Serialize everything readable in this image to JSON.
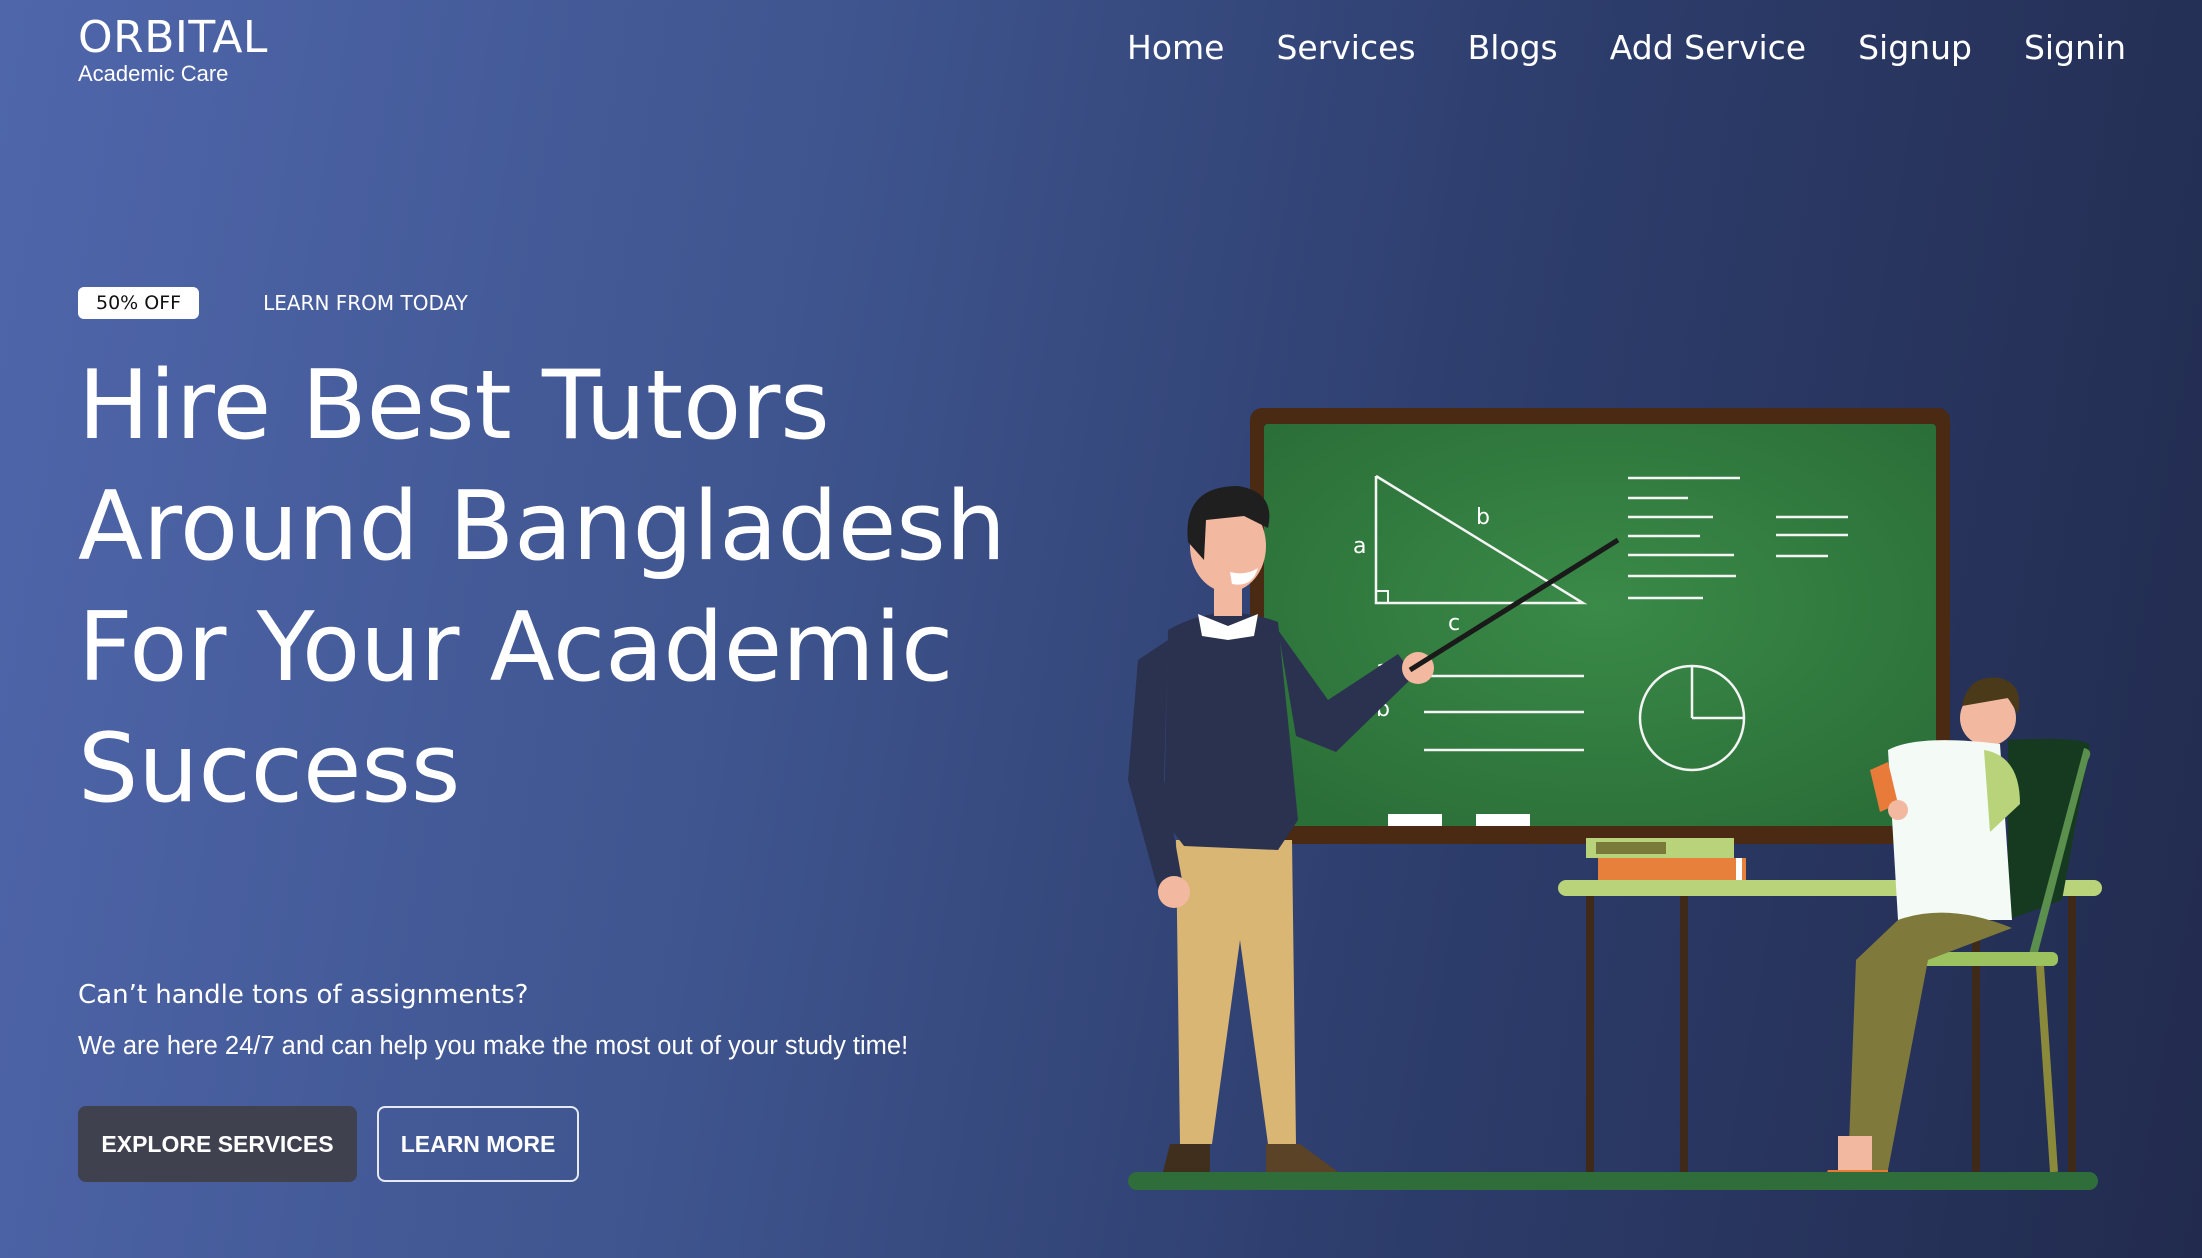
{
  "brand": {
    "name": "ORBITAL",
    "subtitle": "Academic Care"
  },
  "nav": {
    "items": [
      "Home",
      "Services",
      "Blogs",
      "Add Service",
      "Signup",
      "Signin"
    ]
  },
  "hero": {
    "badge": "50% OFF",
    "tagline": "LEARN FROM TODAY",
    "headline_lines": [
      "Hire Best Tutors",
      "Around Bangladesh",
      "For Your Academic",
      "Success"
    ],
    "question": "Can’t handle tons of assignments?",
    "support": "We are here 24/7 and can help you make the most out of your study time!",
    "cta_primary": "EXPLORE SERVICES",
    "cta_secondary": "LEARN MORE"
  },
  "illustration": {
    "label_a": "a",
    "label_b": "b",
    "label_c": "c",
    "icon": "teacher-at-chalkboard-illustration"
  },
  "colors": {
    "chalkboard": "#2f7a3e",
    "frame": "#4a2a12",
    "button_dark": "#40414f"
  }
}
